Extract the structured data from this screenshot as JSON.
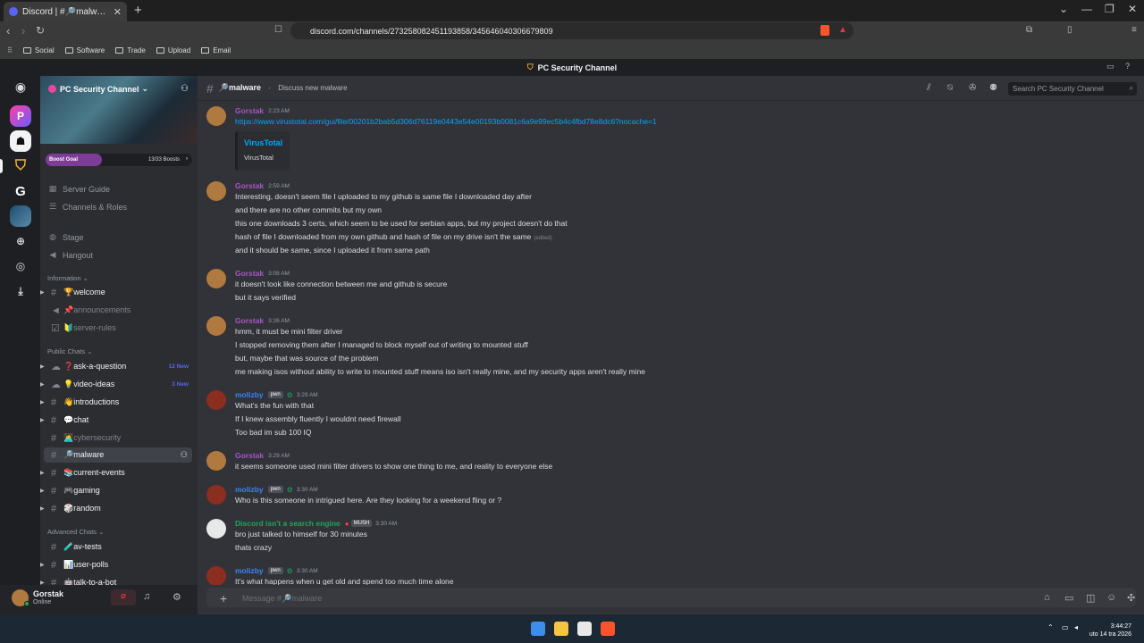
{
  "browser": {
    "tab_title": "Discord | #🔎malware | PC Securi...",
    "url": "discord.com/channels/273258082451193858/345646040306679809",
    "bookmarks": [
      "Social",
      "Software",
      "Trade",
      "Upload",
      "Email"
    ]
  },
  "window_title": "PC Security Channel",
  "server": {
    "name": "PC Security Channel",
    "boost_label": "Boost Goal",
    "boost_count": "13/33 Boosts",
    "items": [
      {
        "icon": "server-guide-icon",
        "label": "Server Guide"
      },
      {
        "icon": "channels-roles-icon",
        "label": "Channels & Roles"
      },
      {
        "icon": "stage-icon",
        "label": "Stage"
      },
      {
        "icon": "speaker-icon",
        "label": "Hangout"
      }
    ],
    "categories": {
      "information": "Information",
      "public": "Public Chats",
      "advanced": "Advanced Chats"
    },
    "info_channels": [
      {
        "name": "🏆welcome",
        "muted": false
      },
      {
        "name": "📌announcements",
        "muted": true
      },
      {
        "name": "🔰server-rules",
        "muted": true
      }
    ],
    "public_channels": [
      {
        "name": "❓ask-a-question",
        "badge": "12 New"
      },
      {
        "name": "💡video-ideas",
        "badge": "3 New"
      },
      {
        "name": "👋introductions",
        "badge": ""
      },
      {
        "name": "💬chat",
        "badge": ""
      },
      {
        "name": "👩‍💻cybersecurity",
        "badge": "",
        "muted": true
      },
      {
        "name": "🔎malware",
        "badge": "",
        "selected": true
      },
      {
        "name": "📚current-events",
        "badge": ""
      },
      {
        "name": "🎮gaming",
        "badge": ""
      },
      {
        "name": "🎲random",
        "badge": ""
      }
    ],
    "advanced_channels": [
      {
        "name": "🧪av-tests"
      },
      {
        "name": "📊user-polls"
      },
      {
        "name": "🤖talk-to-a-bot"
      }
    ]
  },
  "user": {
    "name": "Gorstak",
    "status": "Online"
  },
  "channel": {
    "name": "🔎malware",
    "topic": "Discuss new malware",
    "search_placeholder": "Search PC Security Channel"
  },
  "messages": [
    {
      "author": "Gorstak",
      "time": "2:23 AM",
      "lines": [
        "https://www.virustotal.com/gui/file/00201b2bab5d306d76119e0443e54e00193b0081c6a9e99ec5b4c4fbd78e8dc6?nocache=1"
      ],
      "embed": {
        "title": "VirusTotal",
        "subtitle": "VirusTotal"
      }
    },
    {
      "author": "Gorstak",
      "time": "2:59 AM",
      "lines": [
        "Interesting, doesn't seem file I uploaded to my github is same file I downloaded day after",
        "and there are no other commits but my own",
        "this one downloads 3 certs, which seem to be used for serbian apps, but my project doesn't do that",
        "hash of file I downloaded from my own github and hash of file on my drive isn't the same",
        "and it should be same, since I uploaded it from same path"
      ],
      "edited": "(edited)"
    },
    {
      "author": "Gorstak",
      "time": "3:08 AM",
      "lines": [
        "it doesn't look like connection between me and github is secure",
        "but it says verified"
      ]
    },
    {
      "author": "Gorstak",
      "time": "3:26 AM",
      "lines": [
        "hmm, it must be mini filter driver",
        "I stopped removing them after I managed to block myself out of writing to mounted stuff",
        "but, maybe that was source of the problem",
        "me making isos without ability to write to mounted stuff means iso isn't really mine, and my security apps aren't really mine"
      ]
    },
    {
      "author": "molizby",
      "tag": "pwn",
      "time": "3:29 AM",
      "lines": [
        "What's the fun with that",
        "If I knew assembly fluently I wouldnt need firewall",
        "Too bad im sub 100 IQ"
      ]
    },
    {
      "author": "Gorstak",
      "time": "3:29 AM",
      "lines": [
        "it seems someone used mini filter drivers to show one thing to me, and reality to everyone else"
      ]
    },
    {
      "author": "molizby",
      "tag": "pwn",
      "time": "3:30 AM",
      "lines": [
        "Who is this someone in intrigued here.  Are they looking for a weekend fling or ?"
      ]
    },
    {
      "author": "Discord isn't a search engine",
      "tag": "MUSH",
      "time": "3:30 AM",
      "lines": [
        "bro just talked to himself for 30 minutes",
        "thats crazy"
      ]
    },
    {
      "author": "molizby",
      "tag": "pwn",
      "time": "3:30 AM",
      "lines": [
        "It's what happens when u get old and spend too much time alone"
      ]
    }
  ],
  "composer": {
    "placeholder": "Message #🔎malware"
  },
  "clock": {
    "time": "3:44:27",
    "date": "uto 14 tra 2026"
  },
  "colors": {
    "gorstak": "#a855c7",
    "molizby": "#3b82f6",
    "discord_user": "#22a559"
  }
}
